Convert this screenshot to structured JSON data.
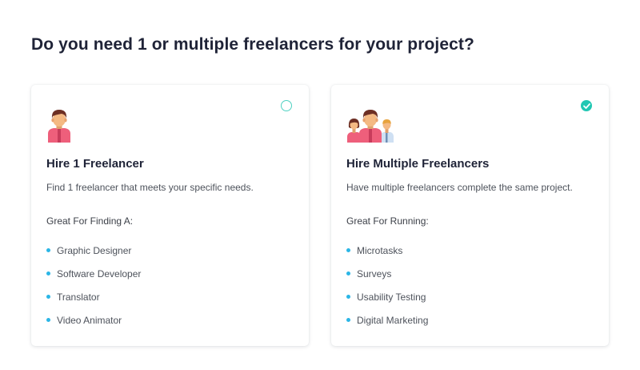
{
  "page": {
    "title": "Do you need 1 or multiple freelancers for your project?"
  },
  "colors": {
    "accent_teal": "#22c7b3",
    "bullet_blue": "#2bb6e6",
    "heading": "#1f2337"
  },
  "options": [
    {
      "title": "Hire 1 Freelancer",
      "description": "Find 1 freelancer that meets your specific needs.",
      "list_heading": "Great For Finding A:",
      "items": [
        "Graphic Designer",
        "Software Developer",
        "Translator",
        "Video Animator"
      ],
      "selected": false,
      "icon": "single-person-icon"
    },
    {
      "title": "Hire Multiple Freelancers",
      "description": "Have multiple freelancers complete the same project.",
      "list_heading": "Great For Running:",
      "items": [
        "Microtasks",
        "Surveys",
        "Usability Testing",
        "Digital Marketing"
      ],
      "selected": true,
      "icon": "group-people-icon"
    }
  ]
}
